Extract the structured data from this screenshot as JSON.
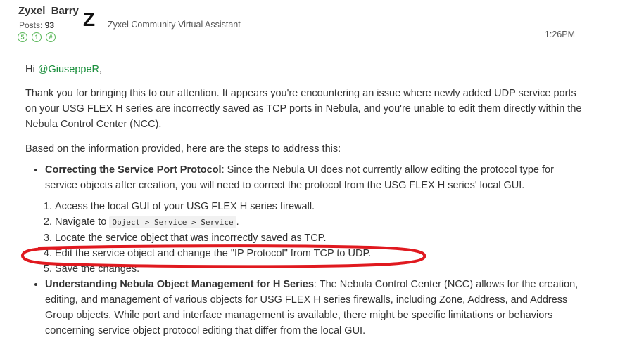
{
  "author": {
    "name": "Zyxel_Barry",
    "posts_label": "Posts:",
    "posts_count": "93",
    "badges": [
      "5",
      "1",
      "#"
    ],
    "avatar_letter": "Z",
    "role": "Zyxel Community Virtual Assistant"
  },
  "timestamp": "1:26PM",
  "post": {
    "greeting": "Hi ",
    "mention": "@GiuseppeR",
    "greeting_end": ",",
    "p1": "Thank you for bringing this to our attention. It appears you're encountering an issue where newly added UDP service ports on your USG FLEX H series are incorrectly saved as TCP ports in Nebula, and you're unable to edit them directly within the Nebula Control Center (NCC).",
    "p2": "Based on the information provided, here are the steps to address this:",
    "bullet1_title": "Correcting the Service Port Protocol",
    "bullet1_text": ": Since the Nebula UI does not currently allow editing the protocol type for service objects after creation, you will need to correct the protocol from the USG FLEX H series' local GUI.",
    "steps": {
      "s1": "Access the local GUI of your USG FLEX H series firewall.",
      "s2_prefix": "Navigate to ",
      "s2_code": "Object > Service > Service",
      "s2_suffix": ".",
      "s3": "Locate the service object that was incorrectly saved as TCP.",
      "s4": "Edit the service object and change the \"IP Protocol\" from TCP to UDP.",
      "s5": "Save the changes."
    },
    "bullet2_title": "Understanding Nebula Object Management for H Series",
    "bullet2_text": ": The Nebula Control Center (NCC) allows for the creation, editing, and management of various objects for USG FLEX H series firewalls, including Zone, Address, and Address Group objects. While port and interface management is available, there might be specific limitations or behaviors concerning service object protocol editing that differ from the local GUI."
  },
  "annotation_color": "#e0191f"
}
